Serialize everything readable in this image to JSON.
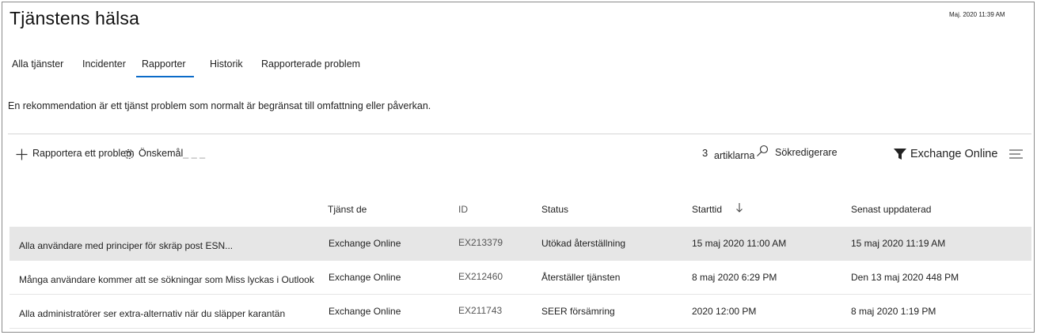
{
  "header": {
    "title": "Tjänstens hälsa",
    "timestamp": "Maj. 2020 11:39 AM"
  },
  "tabs": [
    {
      "label": "Alla tjänster"
    },
    {
      "label": "Incidenter"
    },
    {
      "label": "Rapporter"
    },
    {
      "label": "Historik"
    },
    {
      "label": "Rapporterade problem"
    }
  ],
  "description": "En rekommendation är ett tjänst problem som normalt är begränsat till omfattning eller påverkan.",
  "toolbar": {
    "report_label": "Rapportera ett problem",
    "preferences_label": "Önskemål",
    "item_count": "3",
    "items_label": "artiklarna",
    "search_placeholder": "Sökredigerare",
    "filter_label": "Exchange Online"
  },
  "icons": {
    "report": "plus-icon",
    "preferences": "gear-icon",
    "search": "search-icon",
    "filter": "filter-icon",
    "view": "menu-icon",
    "sort": "arrow-down-icon"
  },
  "colors": {
    "accent": "#0b6bc8",
    "selected_row": "#e6e6e6"
  },
  "table": {
    "columns": [
      "Tjänst de",
      "ID",
      "Status",
      "Starttid",
      "Senast uppdaterad"
    ],
    "rows": [
      {
        "title": "Alla användare med principer för skräp post ESN...",
        "service": "Exchange Online",
        "id": "EX213379",
        "status": "Utökad återställning",
        "start": "15 maj 2020 11:00 AM",
        "updated": "15 maj 2020 11:19 AM"
      },
      {
        "title": "Många användare kommer att se sökningar som Miss lyckas i Outlook",
        "service": "Exchange Online",
        "id": "EX212460",
        "status": "Återställer tjänsten",
        "start": "8 maj 2020 6:29 PM",
        "updated": "Den 13 maj 2020 448 PM"
      },
      {
        "title": "Alla administratörer ser extra-alternativ när du släpper karantän",
        "service": "Exchange Online",
        "id": "EX211743",
        "status": "SEER försämring",
        "start": "2020 12:00 PM",
        "updated": "8 maj 2020 1:19 PM"
      }
    ]
  }
}
